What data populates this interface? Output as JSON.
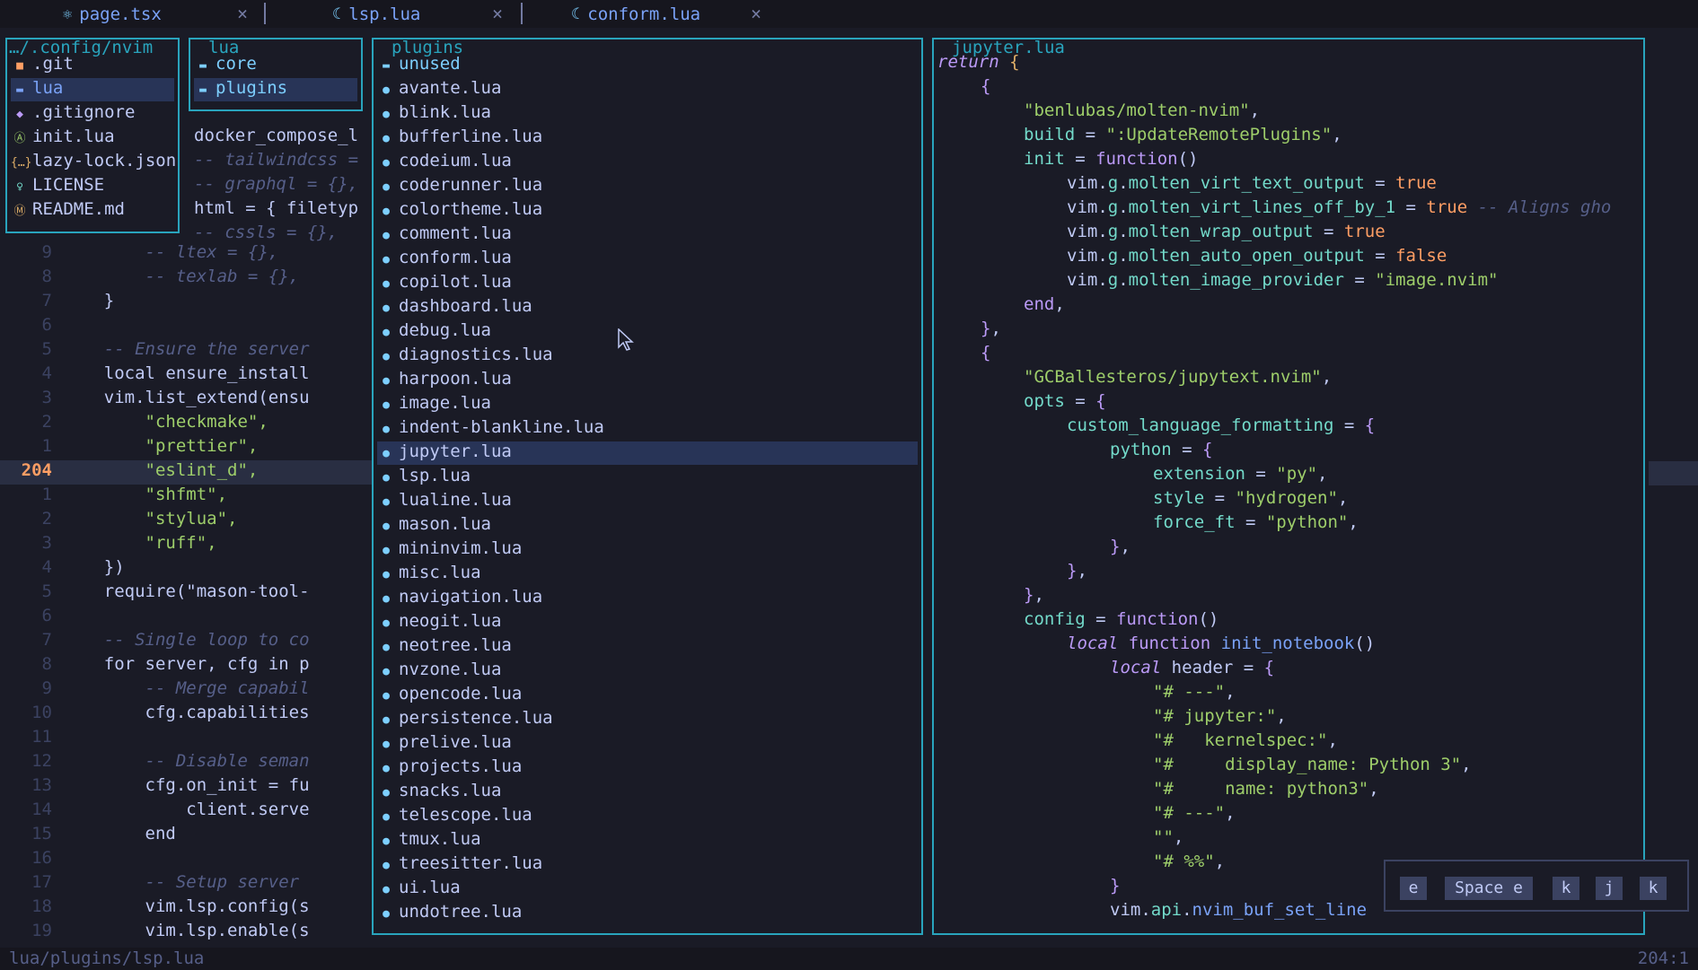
{
  "tabs": [
    {
      "icon": "react-icon",
      "icon_glyph": "⚛",
      "label": "page.tsx",
      "close": "×"
    },
    {
      "icon": "lua-icon",
      "icon_glyph": "☾",
      "label": "lsp.lua",
      "close": "×"
    },
    {
      "icon": "lua-icon",
      "icon_glyph": "☾",
      "label": "conform.lua",
      "close": "×"
    }
  ],
  "code_lines": [
    {
      "ln": "9",
      "text": "        -- ltex = {},"
    },
    {
      "ln": "8",
      "text": "        -- texlab = {},"
    },
    {
      "ln": "7",
      "text": "    }"
    },
    {
      "ln": "6",
      "text": ""
    },
    {
      "ln": "5",
      "text": "    -- Ensure the server"
    },
    {
      "ln": "4",
      "text": "    local ensure_install"
    },
    {
      "ln": "3",
      "text": "    vim.list_extend(ensu"
    },
    {
      "ln": "2",
      "text": "        \"checkmake\","
    },
    {
      "ln": "1",
      "text": "        \"prettier\","
    },
    {
      "ln": "204",
      "text": "        \"eslint_d\","
    },
    {
      "ln": "1",
      "text": "        \"shfmt\","
    },
    {
      "ln": "2",
      "text": "        \"stylua\","
    },
    {
      "ln": "3",
      "text": "        \"ruff\","
    },
    {
      "ln": "4",
      "text": "    })"
    },
    {
      "ln": "5",
      "text": "    require(\"mason-tool-"
    },
    {
      "ln": "6",
      "text": ""
    },
    {
      "ln": "7",
      "text": "    -- Single loop to co"
    },
    {
      "ln": "8",
      "text": "    for server, cfg in p"
    },
    {
      "ln": "9",
      "text": "        -- Merge capabil"
    },
    {
      "ln": "10",
      "text": "        cfg.capabilities"
    },
    {
      "ln": "11",
      "text": ""
    },
    {
      "ln": "12",
      "text": "        -- Disable seman"
    },
    {
      "ln": "13",
      "text": "        cfg.on_init = fu"
    },
    {
      "ln": "14",
      "text": "            client.serve"
    },
    {
      "ln": "15",
      "text": "        end"
    },
    {
      "ln": "16",
      "text": ""
    },
    {
      "ln": "17",
      "text": "        -- Setup server"
    },
    {
      "ln": "18",
      "text": "        vim.lsp.config(s"
    },
    {
      "ln": "19",
      "text": "        vim.lsp.enable(s"
    }
  ],
  "behind_lines": [
    {
      "text": "docker_compose_l"
    },
    {
      "text": "-- tailwindcss ="
    },
    {
      "text": "-- graphql = {},"
    },
    {
      "text": "html = { filetyp"
    },
    {
      "text": "-- cssls = {},"
    }
  ],
  "root_panel": {
    "title": "…/.config/nvim",
    "items": [
      {
        "icon": "git-folder-icon",
        "glyph": "■",
        "label": ".git",
        "color": "#ff9e64"
      },
      {
        "icon": "folder-icon",
        "glyph": "▬",
        "label": "lua",
        "color": "#7aa2f7",
        "selected": true
      },
      {
        "icon": "git-icon",
        "glyph": "◆",
        "label": ".gitignore",
        "color": "#bb9af7"
      },
      {
        "icon": "neovim-icon",
        "glyph": "Ⓐ",
        "label": "init.lua",
        "color": "#9ece6a"
      },
      {
        "icon": "json-icon",
        "glyph": "{…}",
        "label": "lazy-lock.json",
        "color": "#e0af68"
      },
      {
        "icon": "license-icon",
        "glyph": "♀",
        "label": "LICENSE",
        "color": "#73daca"
      },
      {
        "icon": "markdown-icon",
        "glyph": "Ⓜ",
        "label": "README.md",
        "color": "#e0af68"
      }
    ]
  },
  "lua_panel": {
    "title": "lua",
    "items": [
      {
        "icon": "folder-icon",
        "label": "core"
      },
      {
        "icon": "folder-icon",
        "label": "plugins",
        "selected": true
      }
    ]
  },
  "plugins_panel": {
    "title": "plugins",
    "items": [
      {
        "icon": "folder-icon",
        "label": "unused"
      },
      {
        "icon": "lua-icon",
        "label": "avante.lua"
      },
      {
        "icon": "lua-icon",
        "label": "blink.lua"
      },
      {
        "icon": "lua-icon",
        "label": "bufferline.lua"
      },
      {
        "icon": "lua-icon",
        "label": "codeium.lua"
      },
      {
        "icon": "lua-icon",
        "label": "coderunner.lua"
      },
      {
        "icon": "lua-icon",
        "label": "colortheme.lua"
      },
      {
        "icon": "lua-icon",
        "label": "comment.lua"
      },
      {
        "icon": "lua-icon",
        "label": "conform.lua"
      },
      {
        "icon": "lua-icon",
        "label": "copilot.lua"
      },
      {
        "icon": "lua-icon",
        "label": "dashboard.lua"
      },
      {
        "icon": "lua-icon",
        "label": "debug.lua"
      },
      {
        "icon": "lua-icon",
        "label": "diagnostics.lua"
      },
      {
        "icon": "lua-icon",
        "label": "harpoon.lua"
      },
      {
        "icon": "lua-icon",
        "label": "image.lua"
      },
      {
        "icon": "lua-icon",
        "label": "indent-blankline.lua"
      },
      {
        "icon": "lua-icon",
        "label": "jupyter.lua",
        "selected": true
      },
      {
        "icon": "lua-icon",
        "label": "lsp.lua"
      },
      {
        "icon": "lua-icon",
        "label": "lualine.lua"
      },
      {
        "icon": "lua-icon",
        "label": "mason.lua"
      },
      {
        "icon": "lua-icon",
        "label": "mininvim.lua"
      },
      {
        "icon": "lua-icon",
        "label": "misc.lua"
      },
      {
        "icon": "lua-icon",
        "label": "navigation.lua"
      },
      {
        "icon": "lua-icon",
        "label": "neogit.lua"
      },
      {
        "icon": "lua-icon",
        "label": "neotree.lua"
      },
      {
        "icon": "lua-icon",
        "label": "nvzone.lua"
      },
      {
        "icon": "lua-icon",
        "label": "opencode.lua"
      },
      {
        "icon": "lua-icon",
        "label": "persistence.lua"
      },
      {
        "icon": "lua-icon",
        "label": "prelive.lua"
      },
      {
        "icon": "lua-icon",
        "label": "projects.lua"
      },
      {
        "icon": "lua-icon",
        "label": "snacks.lua"
      },
      {
        "icon": "lua-icon",
        "label": "telescope.lua"
      },
      {
        "icon": "lua-icon",
        "label": "tmux.lua"
      },
      {
        "icon": "lua-icon",
        "label": "treesitter.lua"
      },
      {
        "icon": "lua-icon",
        "label": "ui.lua"
      },
      {
        "icon": "lua-icon",
        "label": "undotree.lua"
      }
    ]
  },
  "preview_panel": {
    "title": "jupyter.lua",
    "lines": [
      {
        "indent": 0,
        "segs": [
          [
            "kw",
            "return"
          ],
          [
            "",
            ""
          ],
          [
            "br",
            " {"
          ]
        ]
      },
      {
        "indent": 1,
        "segs": [
          [
            "pun",
            "{"
          ]
        ]
      },
      {
        "indent": 2,
        "segs": [
          [
            "str",
            "\"benlubas/molten-nvim\""
          ],
          [
            "",
            ","
          ]
        ]
      },
      {
        "indent": 2,
        "segs": [
          [
            "prop",
            "build"
          ],
          [
            "",
            " = "
          ],
          [
            "str",
            "\":UpdateRemotePlugins\""
          ],
          [
            "",
            ","
          ]
        ]
      },
      {
        "indent": 2,
        "segs": [
          [
            "prop",
            "init"
          ],
          [
            "",
            " = "
          ],
          [
            "k2",
            "function"
          ],
          [
            "",
            "()"
          ]
        ]
      },
      {
        "indent": 3,
        "segs": [
          [
            "",
            "vim."
          ],
          [
            "prop",
            "g"
          ],
          [
            "",
            "."
          ],
          [
            "prop",
            "molten_virt_text_output"
          ],
          [
            "",
            " = "
          ],
          [
            "bool",
            "true"
          ]
        ]
      },
      {
        "indent": 3,
        "segs": [
          [
            "",
            "vim."
          ],
          [
            "prop",
            "g"
          ],
          [
            "",
            "."
          ],
          [
            "prop",
            "molten_virt_lines_off_by_1"
          ],
          [
            "",
            " = "
          ],
          [
            "bool",
            "true"
          ],
          [
            "cmt",
            " -- Aligns gho"
          ]
        ]
      },
      {
        "indent": 3,
        "segs": [
          [
            "",
            "vim."
          ],
          [
            "prop",
            "g"
          ],
          [
            "",
            "."
          ],
          [
            "prop",
            "molten_wrap_output"
          ],
          [
            "",
            " = "
          ],
          [
            "bool",
            "true"
          ]
        ]
      },
      {
        "indent": 3,
        "segs": [
          [
            "",
            "vim."
          ],
          [
            "prop",
            "g"
          ],
          [
            "",
            "."
          ],
          [
            "prop",
            "molten_auto_open_output"
          ],
          [
            "",
            " = "
          ],
          [
            "bool",
            "false"
          ]
        ]
      },
      {
        "indent": 3,
        "segs": [
          [
            "",
            "vim."
          ],
          [
            "prop",
            "g"
          ],
          [
            "",
            "."
          ],
          [
            "prop",
            "molten_image_provider"
          ],
          [
            "",
            " = "
          ],
          [
            "str",
            "\"image.nvim\""
          ]
        ]
      },
      {
        "indent": 2,
        "segs": [
          [
            "k2",
            "end"
          ],
          [
            "",
            ","
          ]
        ]
      },
      {
        "indent": 1,
        "segs": [
          [
            "pun",
            "}"
          ],
          [
            "",
            ","
          ]
        ]
      },
      {
        "indent": 1,
        "segs": [
          [
            "pun",
            "{"
          ]
        ]
      },
      {
        "indent": 2,
        "segs": [
          [
            "str",
            "\"GCBallesteros/jupytext.nvim\""
          ],
          [
            "",
            ","
          ]
        ]
      },
      {
        "indent": 2,
        "segs": [
          [
            "prop",
            "opts"
          ],
          [
            "",
            " = "
          ],
          [
            "pun",
            "{"
          ]
        ]
      },
      {
        "indent": 3,
        "segs": [
          [
            "prop",
            "custom_language_formatting"
          ],
          [
            "",
            " = "
          ],
          [
            "pun",
            "{"
          ]
        ]
      },
      {
        "indent": 4,
        "segs": [
          [
            "prop",
            "python"
          ],
          [
            "",
            " = "
          ],
          [
            "pun",
            "{"
          ]
        ]
      },
      {
        "indent": 5,
        "segs": [
          [
            "prop",
            "extension"
          ],
          [
            "",
            " = "
          ],
          [
            "str",
            "\"py\""
          ],
          [
            "",
            ","
          ]
        ]
      },
      {
        "indent": 5,
        "segs": [
          [
            "prop",
            "style"
          ],
          [
            "",
            " = "
          ],
          [
            "str",
            "\"hydrogen\""
          ],
          [
            "",
            ","
          ]
        ]
      },
      {
        "indent": 5,
        "segs": [
          [
            "prop",
            "force_ft"
          ],
          [
            "",
            " = "
          ],
          [
            "str",
            "\"python\""
          ],
          [
            "",
            ","
          ]
        ]
      },
      {
        "indent": 4,
        "segs": [
          [
            "pun",
            "}"
          ],
          [
            "",
            ","
          ]
        ]
      },
      {
        "indent": 3,
        "segs": [
          [
            "pun",
            "}"
          ],
          [
            "",
            ","
          ]
        ]
      },
      {
        "indent": 2,
        "segs": [
          [
            "pun",
            "}"
          ],
          [
            "",
            ","
          ]
        ]
      },
      {
        "indent": 2,
        "segs": [
          [
            "prop",
            "config"
          ],
          [
            "",
            " = "
          ],
          [
            "k2",
            "function"
          ],
          [
            "",
            "()"
          ]
        ]
      },
      {
        "indent": 3,
        "segs": [
          [
            "kw",
            "local"
          ],
          [
            "",
            " "
          ],
          [
            "k2",
            "function"
          ],
          [
            "",
            " "
          ],
          [
            "fn",
            "init_notebook"
          ],
          [
            "",
            "()"
          ]
        ]
      },
      {
        "indent": 4,
        "segs": [
          [
            "kw",
            "local"
          ],
          [
            "",
            " header = "
          ],
          [
            "pun",
            "{"
          ]
        ]
      },
      {
        "indent": 5,
        "segs": [
          [
            "str",
            "\"# ---\""
          ],
          [
            "",
            ","
          ]
        ]
      },
      {
        "indent": 5,
        "segs": [
          [
            "str",
            "\"# jupyter:\""
          ],
          [
            "",
            ","
          ]
        ]
      },
      {
        "indent": 5,
        "segs": [
          [
            "str",
            "\"#   kernelspec:\""
          ],
          [
            "",
            ","
          ]
        ]
      },
      {
        "indent": 5,
        "segs": [
          [
            "str",
            "\"#     display_name: Python 3\""
          ],
          [
            "",
            ","
          ]
        ]
      },
      {
        "indent": 5,
        "segs": [
          [
            "str",
            "\"#     name: python3\""
          ],
          [
            "",
            ","
          ]
        ]
      },
      {
        "indent": 5,
        "segs": [
          [
            "str",
            "\"# ---\""
          ],
          [
            "",
            ","
          ]
        ]
      },
      {
        "indent": 5,
        "segs": [
          [
            "str",
            "\"\""
          ],
          [
            "",
            ","
          ]
        ]
      },
      {
        "indent": 5,
        "segs": [
          [
            "str",
            "\"# %%\""
          ],
          [
            "",
            ","
          ]
        ]
      },
      {
        "indent": 4,
        "segs": [
          [
            "pun",
            "}"
          ]
        ]
      },
      {
        "indent": 4,
        "segs": [
          [
            "",
            "vim."
          ],
          [
            "prop",
            "api"
          ],
          [
            "",
            "."
          ],
          [
            "fn",
            "nvim_buf_set_line"
          ]
        ]
      }
    ]
  },
  "keys": [
    "e",
    "Space e",
    "k",
    "j",
    "k"
  ],
  "status": {
    "path": "lua/plugins/lsp.lua",
    "position": "204:1"
  }
}
